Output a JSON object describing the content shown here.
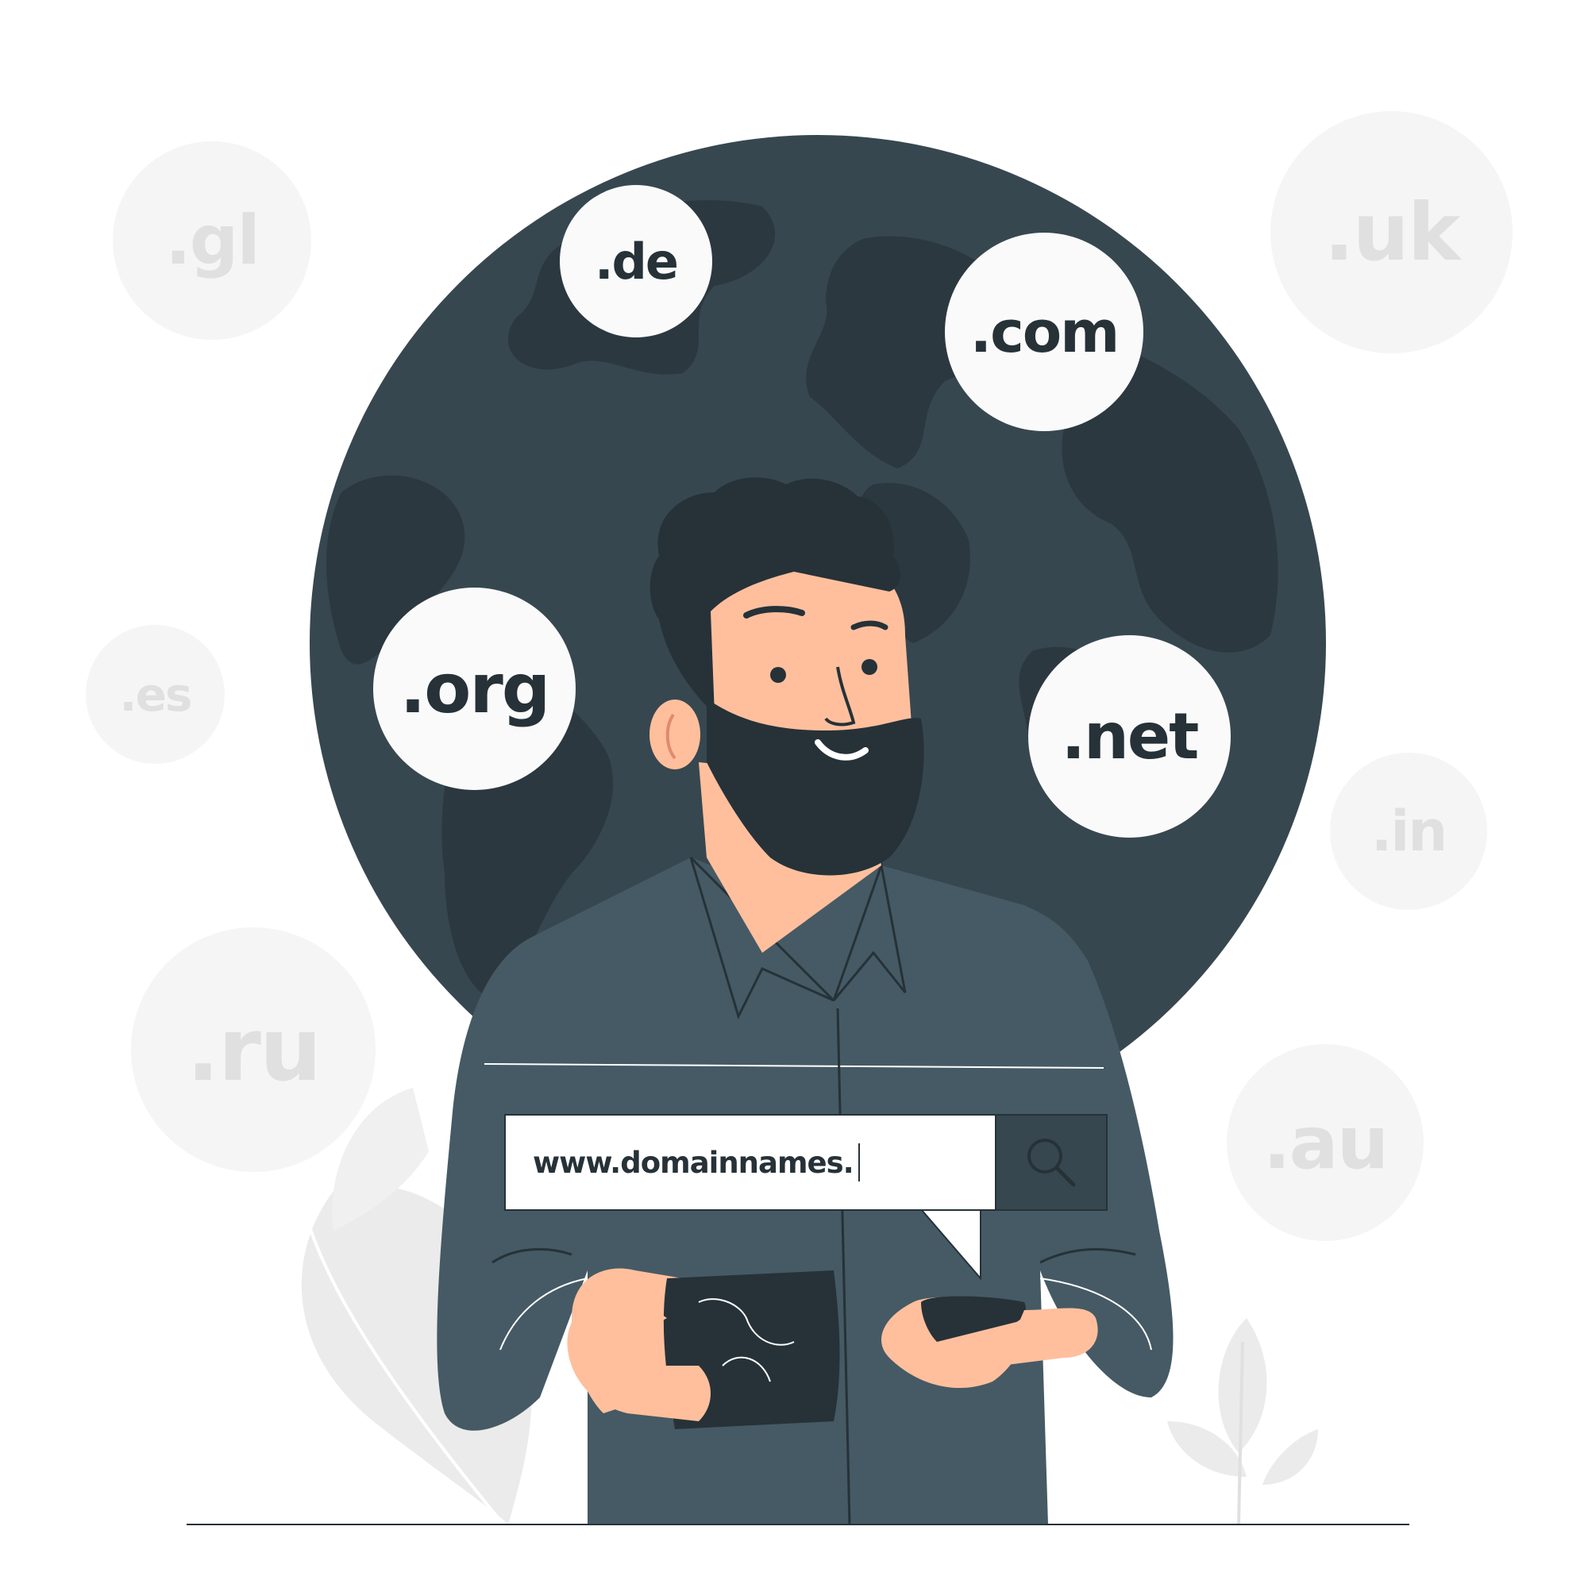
{
  "background_tlds": [
    {
      "id": "gl",
      "label": ".gl"
    },
    {
      "id": "uk",
      "label": ".uk"
    },
    {
      "id": "es",
      "label": ".es"
    },
    {
      "id": "in",
      "label": ".in"
    },
    {
      "id": "ru",
      "label": ".ru"
    },
    {
      "id": "au",
      "label": ".au"
    }
  ],
  "featured_tlds": [
    {
      "id": "de",
      "label": ".de"
    },
    {
      "id": "com",
      "label": ".com"
    },
    {
      "id": "org",
      "label": ".org"
    },
    {
      "id": "net",
      "label": ".net"
    }
  ],
  "search": {
    "value": "www.domainnames.",
    "button_icon": "search-icon"
  },
  "colors": {
    "globe": "#37474f",
    "globe_land": "#2c3840",
    "dark": "#263238",
    "shirt": "#455a64",
    "skin": "#ffbf9d",
    "bubble_light": "#f5f5f5",
    "bubble_text_light": "#e0e0e0",
    "bubble_white": "#fafafa",
    "plant": "#ebebeb"
  }
}
